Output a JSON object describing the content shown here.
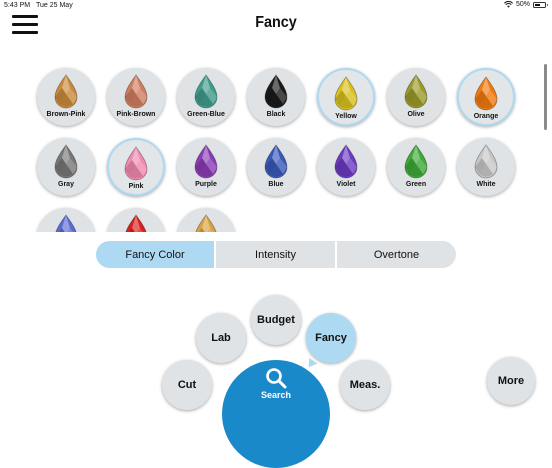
{
  "status": {
    "time": "5:43 PM",
    "date": "Tue 25 May",
    "battery": "50%",
    "battery_level": 0.5
  },
  "header": {
    "title": "Fancy"
  },
  "gems": [
    {
      "label": "Brown-Pink",
      "color": "#c98a3b",
      "selected": false
    },
    {
      "label": "Pink-Brown",
      "color": "#cf7d5f",
      "selected": false
    },
    {
      "label": "Green-Blue",
      "color": "#3f9c8a",
      "selected": false
    },
    {
      "label": "Black",
      "color": "#1b1b1b",
      "selected": false
    },
    {
      "label": "Yellow",
      "color": "#d8c020",
      "selected": true
    },
    {
      "label": "Olive",
      "color": "#9a9a2a",
      "selected": false
    },
    {
      "label": "Orange",
      "color": "#f07a10",
      "selected": true
    },
    {
      "label": "Gray",
      "color": "#777777",
      "selected": false
    },
    {
      "label": "Pink",
      "color": "#f08ab0",
      "selected": true
    },
    {
      "label": "Purple",
      "color": "#8a3cb4",
      "selected": false
    },
    {
      "label": "Blue",
      "color": "#3a58b8",
      "selected": false
    },
    {
      "label": "Violet",
      "color": "#6a3ac0",
      "selected": false
    },
    {
      "label": "Green",
      "color": "#3ea838",
      "selected": false
    },
    {
      "label": "White",
      "color": "#c8c8c8",
      "selected": false
    },
    {
      "label": "",
      "color": "#5a6ad0",
      "selected": false
    },
    {
      "label": "",
      "color": "#d81e1e",
      "selected": false
    },
    {
      "label": "",
      "color": "#d8a040",
      "selected": false
    }
  ],
  "segments": [
    {
      "label": "Fancy Color",
      "active": true
    },
    {
      "label": "Intensity",
      "active": false
    },
    {
      "label": "Overtone",
      "active": false
    }
  ],
  "nav": {
    "budget": "Budget",
    "lab": "Lab",
    "fancy": "Fancy",
    "cut": "Cut",
    "meas": "Meas.",
    "search": "Search",
    "more": "More"
  },
  "icons": [
    "menu-icon",
    "wifi-icon",
    "battery-icon",
    "diamond-icon",
    "search-icon"
  ]
}
